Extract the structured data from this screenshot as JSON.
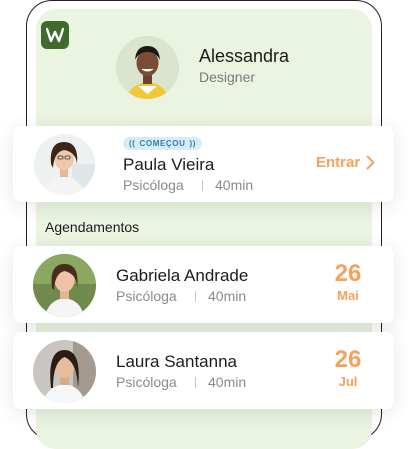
{
  "user": {
    "name": "Alessandra",
    "role": "Designer"
  },
  "current_session": {
    "status_badge": "COMEÇOU",
    "name": "Paula Vieira",
    "role": "Psicóloga",
    "duration": "40min",
    "action_label": "Entrar"
  },
  "appointments_title": "Agendamentos",
  "appointments": [
    {
      "name": "Gabriela Andrade",
      "role": "Psicóloga",
      "duration": "40min",
      "day": "26",
      "month": "Mai"
    },
    {
      "name": "Laura Santanna",
      "role": "Psicóloga",
      "duration": "40min",
      "day": "26",
      "month": "Jul"
    }
  ],
  "colors": {
    "accent_orange": "#f5a25a",
    "brand_green": "#3f6b2f",
    "screen_bg": "#ebf4e1",
    "badge_bg": "#d8ecf8",
    "badge_text": "#2b7fb5"
  }
}
